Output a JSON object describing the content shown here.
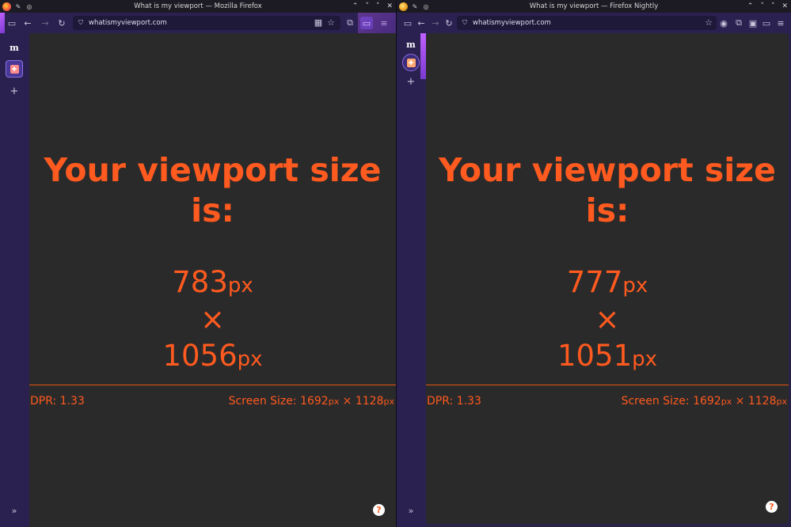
{
  "left": {
    "title": "What is my viewport — Mozilla Firefox",
    "url": "whatismyviewport.com",
    "heading": "Your viewport size is:",
    "width": "783",
    "height": "1056",
    "unit": "px",
    "times": "×",
    "dpr_label": "DPR: 1.33",
    "screen_label": "Screen Size: ",
    "screen_w": "1692",
    "screen_h": "1128"
  },
  "right": {
    "title": "What is my viewport — Firefox Nightly",
    "url": "whatismyviewport.com",
    "heading": "Your viewport size is:",
    "width": "777",
    "height": "1051",
    "unit": "px",
    "times": "×",
    "dpr_label": "DPR: 1.33",
    "screen_label": "Screen Size: ",
    "screen_w": "1692",
    "screen_h": "1128"
  },
  "sidebar_logo": "m",
  "help": "?",
  "icons": {
    "sidebar_toggle": "sidebar-icon",
    "back": "back-arrow-icon",
    "forward": "forward-arrow-icon",
    "reload": "reload-icon",
    "shield": "shield-icon",
    "extensions": "puzzle-icon",
    "bookmark": "star-icon",
    "menu": "hamburger-icon"
  },
  "colors": {
    "accent": "#ff5a1f",
    "toolbar": "#2b2151",
    "page_bg": "#2a2a2a"
  }
}
